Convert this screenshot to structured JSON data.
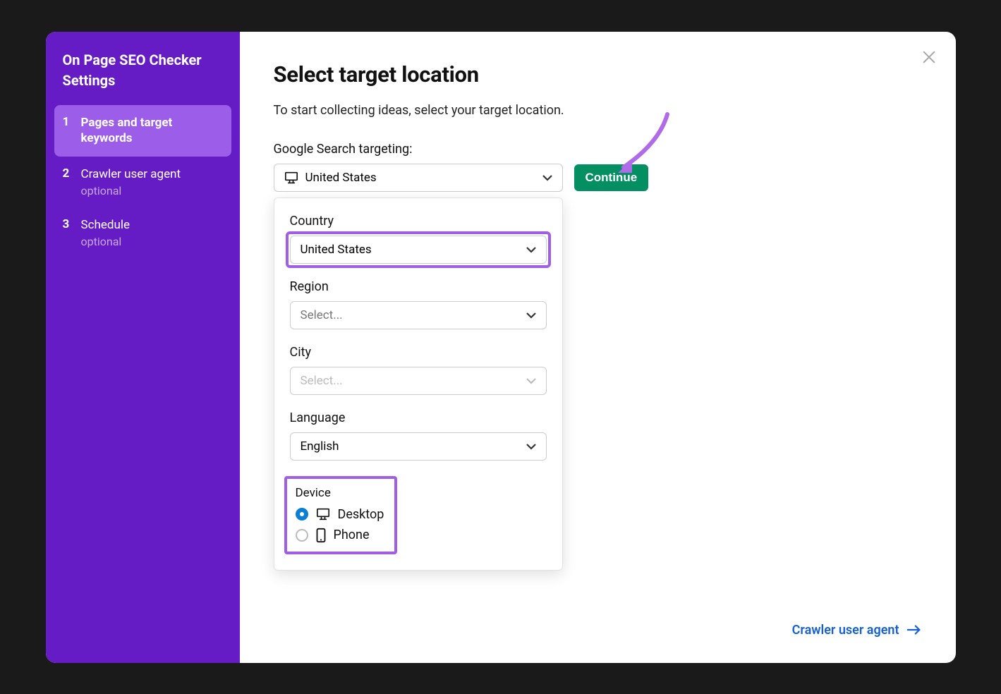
{
  "sidebar": {
    "title": "On Page SEO Checker Settings",
    "steps": [
      {
        "num": "1",
        "label": "Pages and target keywords",
        "optional": null,
        "active": true
      },
      {
        "num": "2",
        "label": "Crawler user agent",
        "optional": "optional",
        "active": false
      },
      {
        "num": "3",
        "label": "Schedule",
        "optional": "optional",
        "active": false
      }
    ]
  },
  "main": {
    "heading": "Select target location",
    "subtitle": "To start collecting ideas, select your target location.",
    "targeting_label": "Google Search targeting:",
    "target_value": "United States",
    "continue_label": "Continue"
  },
  "dropdown": {
    "country_label": "Country",
    "country_value": "United States",
    "region_label": "Region",
    "region_placeholder": "Select...",
    "city_label": "City",
    "city_placeholder": "Select...",
    "language_label": "Language",
    "language_value": "English",
    "device_label": "Device",
    "device_desktop": "Desktop",
    "device_phone": "Phone"
  },
  "footer": {
    "next_label": "Crawler user agent"
  }
}
